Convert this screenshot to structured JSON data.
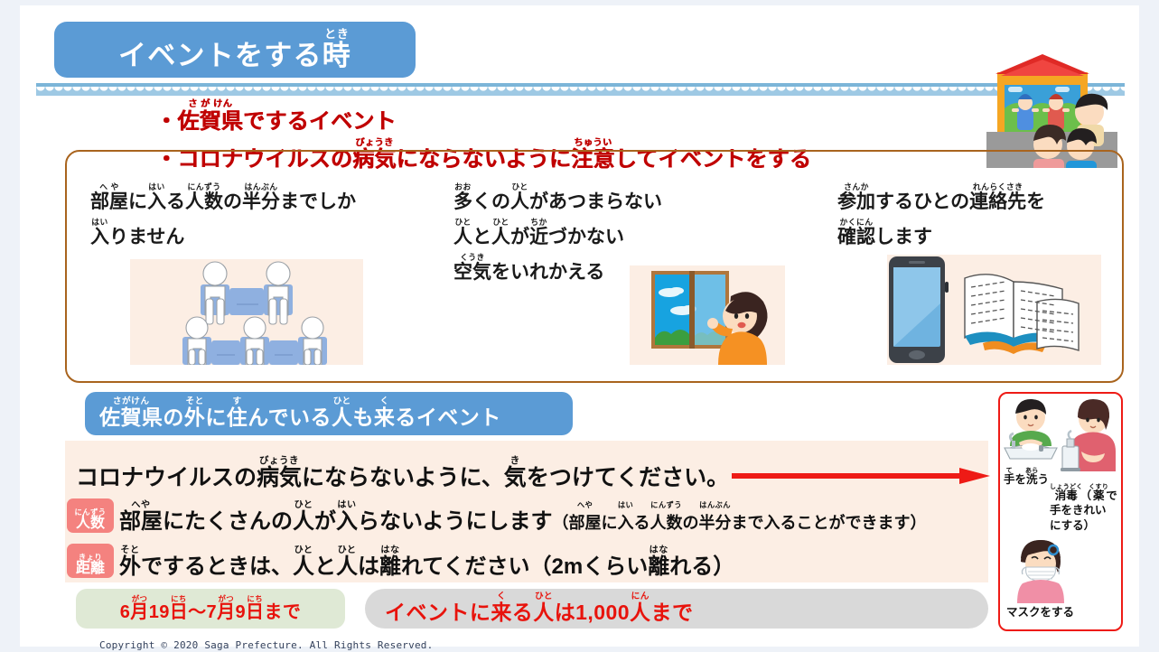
{
  "slide": {
    "title": {
      "base": "イベントをする時",
      "ruby_over": "とき",
      "ruby_base_tail": "時"
    },
    "bullets": [
      {
        "text": "・佐賀県でするイベント",
        "ruby": "さ が けん"
      },
      {
        "text": "・コロナウイルスの病気にならないように注意してイベントをする",
        "ruby": "びょうき / ちゅうい"
      }
    ],
    "columns": [
      {
        "id": "capacity",
        "lines": [
          "部屋に入る人数の半分までしか",
          "入りません"
        ],
        "ruby": [
          "へ や / はい / にんずう / はんぶん",
          "はい"
        ],
        "illustration": "spaced-seating-illustration"
      },
      {
        "id": "distance",
        "lines": [
          "多くの人があつまらない",
          "人と人が近づかない",
          "空気をいれかえる"
        ],
        "ruby": [
          "おお / ひと",
          "ひと / ひと / ちか",
          "くうき"
        ],
        "illustration": "open-window-illustration"
      },
      {
        "id": "contact",
        "lines": [
          "参加するひとの連絡先を",
          "確認します"
        ],
        "ruby": [
          "さんか / れんらくさき",
          "かくにん"
        ],
        "illustration": "phone-and-books-illustration"
      }
    ],
    "sub_banner": {
      "text": "佐賀県の外に住んでいる人も来るイベント",
      "ruby": "さがけん / そと / す / ひと / く"
    },
    "pink_panel": {
      "line1": "コロナウイルスの病気にならないように、気をつけてください。",
      "line1_ruby": "びょうき / き",
      "line2_tag": "人数",
      "line2_tag_ruby": "にんずう",
      "line2": "部屋にたくさんの人が入らないようにします",
      "line2_ruby": "へや / ひと / はい",
      "line2_paren": "（部屋に入る人数の半分まで入ることができます）",
      "line2_paren_ruby": "へや / はい / にんずう / はんぶん",
      "line3_tag": "距離",
      "line3_tag_ruby": "きょり",
      "line3": "外でするときは、人と人は離れてください（2mくらい離れる）",
      "line3_ruby": "そと / ひと / ひと / はな / はな"
    },
    "period_box": {
      "text": "6月19日〜7月9日まで",
      "ruby": "がつ / にち / がつ / にち"
    },
    "capacity_box": {
      "text": "イベントに来る人は1,000人まで",
      "ruby": "く / ひと / にん"
    },
    "prevention_panel": {
      "items": [
        {
          "label": "手を洗う",
          "ruby": "て / あら",
          "illustration": "handwashing-illustration"
        },
        {
          "label": "消毒（薬で手をきれいにする）",
          "ruby": "しょうどく / くすり",
          "illustration": "sanitizer-illustration"
        },
        {
          "label": "マスクをする",
          "ruby": "",
          "illustration": "mask-illustration"
        }
      ]
    },
    "footer": "Copyright © 2020 Saga Prefecture. All Rights Reserved.",
    "colors": {
      "title_blue": "#5b9bd5",
      "bullet_red": "#c00000",
      "box_brown": "#a9641e",
      "peach": "#fceee4",
      "tag_pink": "#f4827f",
      "panel_red": "#ee1b16",
      "green": "#dfe9d5",
      "gray": "#d9d9d9",
      "number_red": "#e8130c"
    }
  }
}
